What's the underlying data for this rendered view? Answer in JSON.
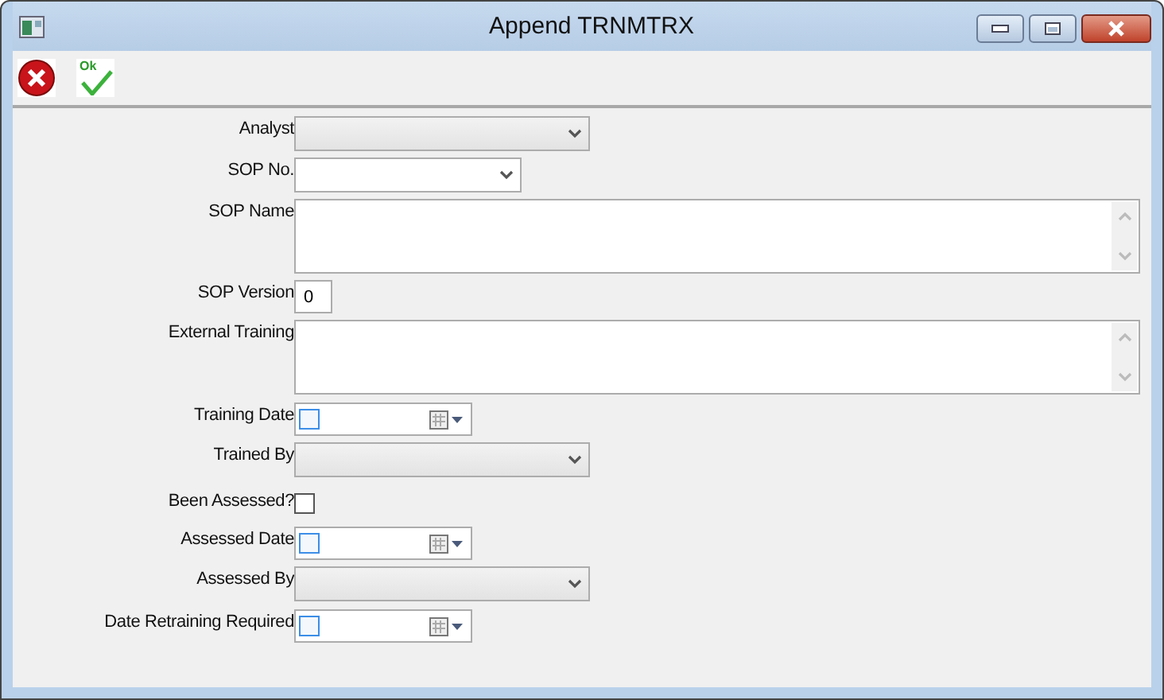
{
  "window": {
    "title": "Append TRNMTRX"
  },
  "toolbar": [
    {
      "kind": "cancel"
    },
    {
      "kind": "ok",
      "label": "Ok"
    }
  ],
  "fields": [
    {
      "kind": "combo",
      "label": "Analyst",
      "disabled": true
    },
    {
      "kind": "combo",
      "label": "SOP No.",
      "disabled": false
    },
    {
      "kind": "memo",
      "label": "SOP Name"
    },
    {
      "kind": "number",
      "label": "SOP Version",
      "value": "0"
    },
    {
      "kind": "memo",
      "label": "External Training"
    },
    {
      "kind": "date",
      "label": "Training Date",
      "checked": false
    },
    {
      "kind": "combo",
      "label": "Trained By",
      "disabled": true
    },
    {
      "kind": "checkbox",
      "label": "Been Assessed?",
      "checked": false
    },
    {
      "kind": "date",
      "label": "Assessed Date",
      "checked": false
    },
    {
      "kind": "combo",
      "label": "Assessed By",
      "disabled": true
    },
    {
      "kind": "date",
      "label": "Date Retraining Required",
      "checked": false
    }
  ]
}
